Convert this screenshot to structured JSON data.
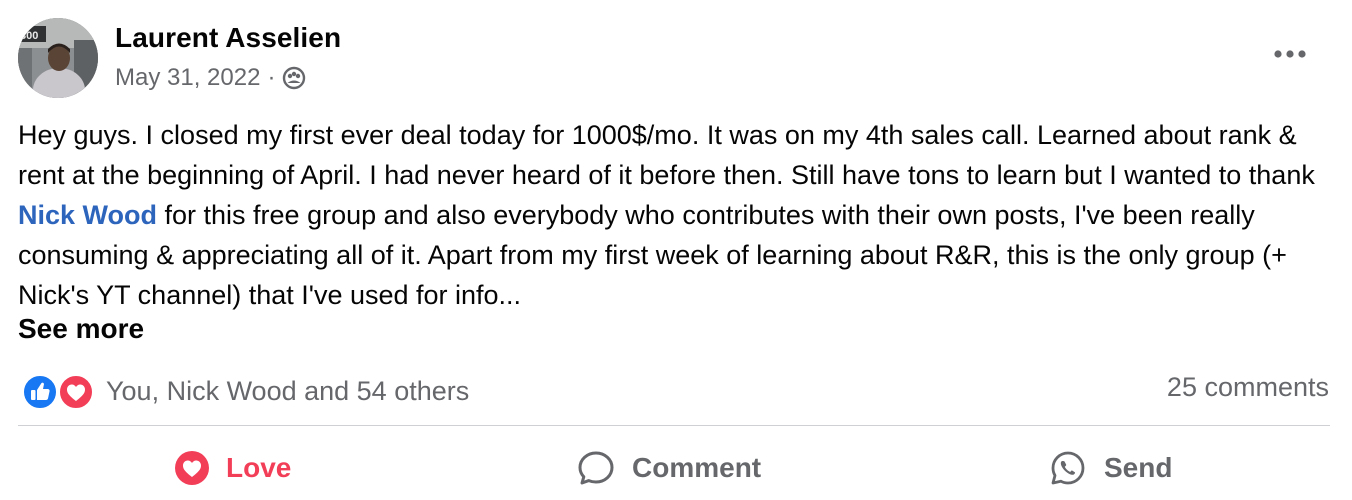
{
  "post": {
    "author": "Laurent Asselien",
    "date": "May 31, 2022",
    "separator": "·",
    "audience_icon": "group-icon",
    "avatar_text": "300",
    "text": {
      "before_mention": "Hey guys. I closed my first ever deal today for 1000$/mo. It was on my 4th sales call. Learned about rank & rent at the beginning of April. I had never heard of it before then. Still have tons to learn but I wanted to thank ",
      "mention": "Nick Wood",
      "after_mention": " for this free group and also everybody who contributes with their own posts, I've been really consuming & appreciating all of it. Apart from my first week of learning about R&R, this is the only group (+ Nick's YT channel) that I've used for info..."
    },
    "see_more_label": "See more"
  },
  "engagement": {
    "reaction_icons": [
      "like-icon",
      "heart-icon"
    ],
    "reactions_summary": "You, Nick Wood and 54 others",
    "comments_label": "25 comments"
  },
  "actions": {
    "love_label": "Love",
    "comment_label": "Comment",
    "send_label": "Send"
  },
  "colors": {
    "love": "#f33e58",
    "mention": "#2d64bc",
    "secondary_text": "#65676b",
    "like_blue": "#1877f2"
  }
}
